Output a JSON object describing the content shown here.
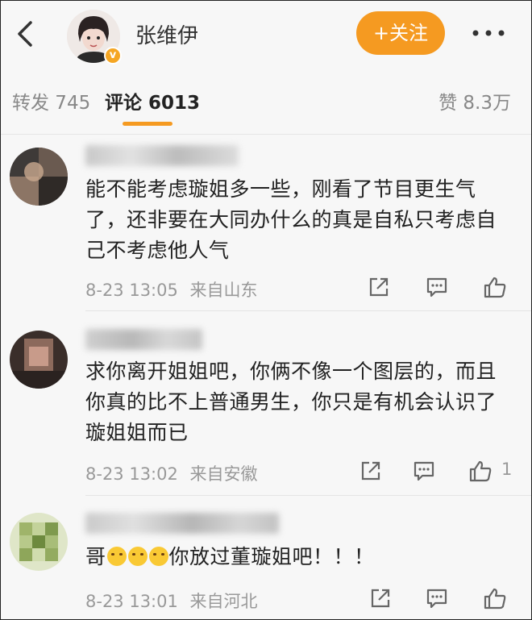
{
  "header": {
    "username": "张维伊",
    "follow_label": "+关注"
  },
  "tabs": {
    "repost": "转发 745",
    "comments": "评论 6013",
    "likes": "赞 8.3万"
  },
  "comments": [
    {
      "text": "能不能考虑璇姐多一些，刚看了节目更生气了，还非要在大同办什么的真是自私只考虑自己不考虑他人气",
      "time": "8-23 13:05",
      "location": "来自山东",
      "like_count": ""
    },
    {
      "text": "求你离开姐姐吧，你俩不像一个图层的，而且你真的比不上普通男生，你只是有机会认识了璇姐姐而已",
      "time": "8-23 13:02",
      "location": "来自安徽",
      "like_count": "1"
    },
    {
      "text_before": "哥",
      "text_after": "你放过董璇姐吧！！！",
      "emoji": "crying-emoji",
      "time": "8-23 13:01",
      "location": "来自河北",
      "like_count": ""
    }
  ],
  "colors": {
    "accent": "#f59a21",
    "background": "#f7f7f7",
    "meta_text": "#999999"
  }
}
